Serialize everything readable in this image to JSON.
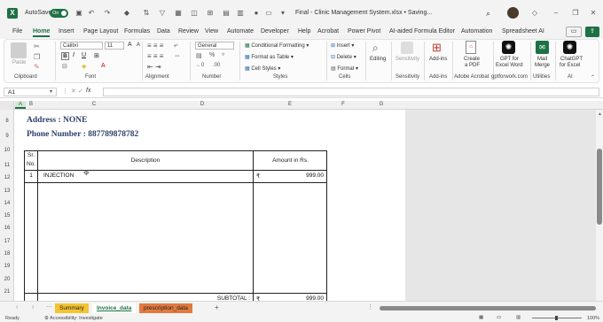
{
  "titlebar": {
    "app_letter": "X",
    "autosave_label": "AutoSave",
    "autosave_state": "On",
    "document_title": "Final - Clinic Management System.xlsx • Saving...",
    "search_icon": "search-icon"
  },
  "menu_tabs": [
    "File",
    "Home",
    "Insert",
    "Page Layout",
    "Formulas",
    "Data",
    "Review",
    "View",
    "Automate",
    "Developer",
    "Help",
    "Acrobat",
    "Power Pivot",
    "AI-aided Formula Editor",
    "Automation",
    "Spreadsheet AI"
  ],
  "ribbon": {
    "clipboard": {
      "paste_label": "Paste",
      "group_label": "Clipboard"
    },
    "font": {
      "font_name": "Calibri",
      "font_size": "11",
      "group_label": "Font"
    },
    "alignment": {
      "group_label": "Alignment"
    },
    "number": {
      "format": "General",
      "group_label": "Number"
    },
    "styles": {
      "conditional": "Conditional Formatting",
      "table": "Format as Table",
      "cell_styles": "Cell Styles",
      "group_label": "Styles"
    },
    "cells": {
      "insert": "Insert",
      "delete": "Delete",
      "format": "Format",
      "group_label": "Cells"
    },
    "editing": {
      "label": "Editing"
    },
    "sensitivity": {
      "label": "Sensitivity",
      "group_label": "Sensitivity"
    },
    "addins": {
      "label": "Add-ins",
      "group_label": "Add-ins"
    },
    "acrobat": {
      "label1": "Create",
      "label2": "a PDF",
      "group_label": "Adobe Acrobat"
    },
    "gpt_word": {
      "label1": "GPT for",
      "label2": "Excel Word",
      "group_label": "gptforwork.com"
    },
    "mail_merge": {
      "label1": "Mail",
      "label2": "Merge",
      "group_label": "Utilities"
    },
    "chatgpt": {
      "label1": "ChatGPT",
      "label2": "for Excel",
      "group_label": "AI"
    }
  },
  "formula_bar": {
    "name_box": "A1",
    "fx_label": "fx",
    "value": ""
  },
  "columns": [
    "A",
    "B",
    "C",
    "D",
    "E",
    "F",
    "G"
  ],
  "rows": [
    "8",
    "9",
    "10",
    "11",
    "12",
    "13",
    "14",
    "15",
    "16",
    "17",
    "18",
    "19",
    "20",
    "21"
  ],
  "sheet": {
    "address": "Address : NONE",
    "phone": "Phone Number : 887789878782",
    "table_headers": {
      "sr": "Sr.",
      "no": "No.",
      "description": "Description",
      "amount": "Amount in Rs."
    },
    "line_items": [
      {
        "sr": "1",
        "description": "INJECTION",
        "currency": "₹",
        "amount": "999.00"
      }
    ],
    "subtotal_label": "SUBTOTAL :",
    "subtotal_currency": "₹",
    "subtotal_amount": "999.00"
  },
  "sheet_tabs": [
    {
      "label": "Summary",
      "color": "#f4c430"
    },
    {
      "label": "Invoice_data",
      "color": "#e6e6e6"
    },
    {
      "label": "prescription_data",
      "color": "#e27a3f"
    }
  ],
  "add_sheet_label": "+",
  "statusbar": {
    "ready": "Ready",
    "accessibility": "Accessibility: Investigate",
    "zoom": "100%"
  }
}
